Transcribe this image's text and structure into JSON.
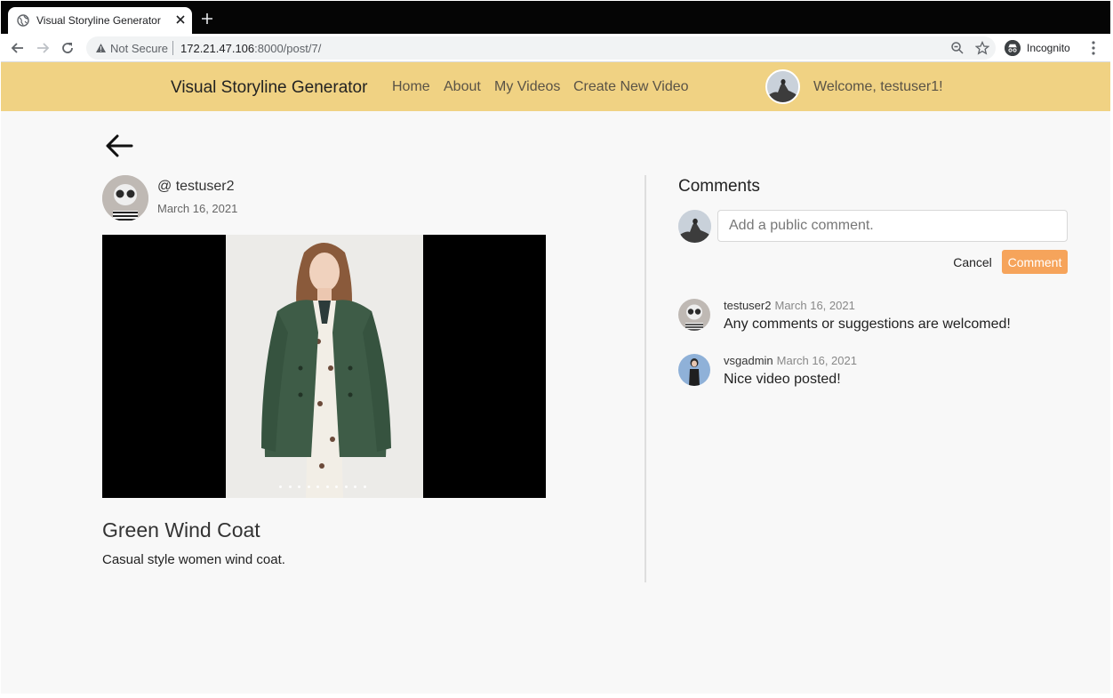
{
  "browser": {
    "tab_title": "Visual Storyline Generator",
    "security_label": "Not Secure",
    "url_host": "172.21.47.106",
    "url_rest": ":8000/post/7/",
    "incognito_label": "Incognito"
  },
  "nav": {
    "brand": "Visual Storyline Generator",
    "links": [
      "Home",
      "About",
      "My Videos",
      "Create New Video"
    ],
    "welcome": "Welcome, testuser1!"
  },
  "post": {
    "author_handle": "@ testuser2",
    "date": "March 16, 2021",
    "title": "Green Wind Coat",
    "description": "Casual style women wind coat.",
    "video_progress_dots": 10
  },
  "comments": {
    "heading": "Comments",
    "input_placeholder": "Add a public comment.",
    "cancel_label": "Cancel",
    "submit_label": "Comment",
    "items": [
      {
        "user": "testuser2",
        "date": "March 16, 2021",
        "text": "Any comments or suggestions are welcomed!"
      },
      {
        "user": "vsgadmin",
        "date": "March 16, 2021",
        "text": "Nice video posted!"
      }
    ]
  },
  "colors": {
    "navbar_bg": "#f0d283",
    "comment_button": "#f6a45b"
  },
  "icons": [
    "globe-icon",
    "close-icon",
    "plus-icon",
    "back-icon",
    "forward-icon",
    "reload-icon",
    "warning-icon",
    "zoom-icon",
    "star-icon",
    "incognito-icon",
    "more-vert-icon",
    "back-arrow-icon"
  ]
}
